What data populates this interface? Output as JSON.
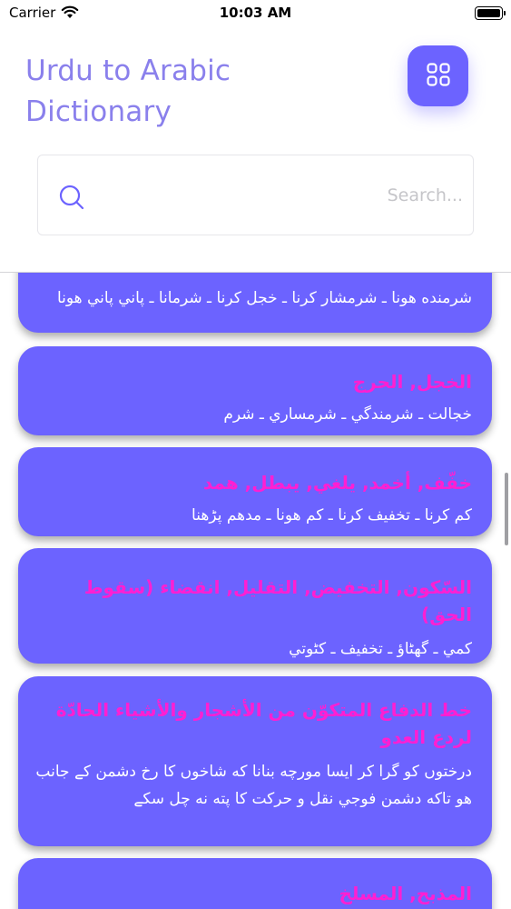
{
  "status_bar": {
    "carrier": "Carrier",
    "time": "10:03 AM"
  },
  "header": {
    "title": "Urdu to Arabic Dictionary",
    "menu_icon": "grid-icon",
    "accent_color": "#6c63ff"
  },
  "search": {
    "placeholder": "Search...",
    "value": ""
  },
  "entries": [
    {
      "arabic": "",
      "urdu": "شرمنده هونا ـ شرمشار كرنا ـ خجل كرنا ـ شرمانا ـ پاني پاني هونا"
    },
    {
      "arabic": "الخجل, الحرج",
      "urdu": "خجالت ـ شرمندگي ـ شرمساري ـ شرم"
    },
    {
      "arabic": "خفّف, أخمد, يلغي, يبطل, همد",
      "urdu": "كم كرنا ـ تخفيف كرنا ـ كم هونا ـ مدهم پڑهنا"
    },
    {
      "arabic": "السّكون, التخفيض, التقليل, انقضاء (سقوط الحق)",
      "urdu": "كمي ـ گھٹاؤ ـ تخفيف ـ كٹوتي"
    },
    {
      "arabic": "خط الدفاع المتكوّن من الأشجار والأشياء الحادّة لردع العدو",
      "urdu": "درختوں كو گرا كر ايسا مورچه بنانا كه شاخوں كا رخ دشمن كے جانب هو تاكه دشمن فوجي نقل و حركت كا پته نه چل سكے"
    },
    {
      "arabic": "المذبح, المسلخ",
      "urdu": ""
    }
  ]
}
